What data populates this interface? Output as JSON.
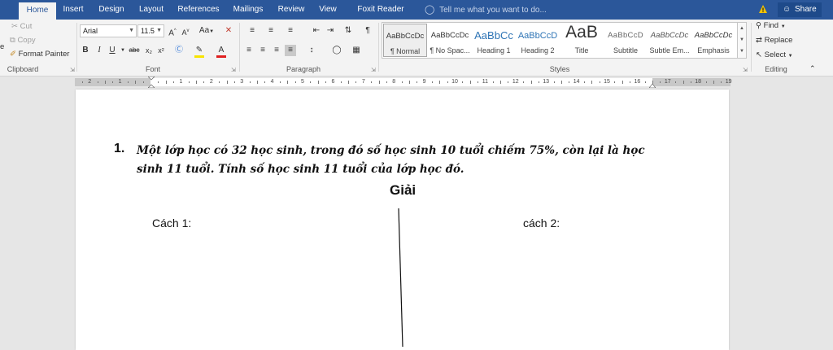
{
  "tabs": [
    "Home",
    "Insert",
    "Design",
    "Layout",
    "References",
    "Mailings",
    "Review",
    "View",
    "Foxit Reader PDF"
  ],
  "tell_me": "Tell me what you want to do...",
  "share": "Share",
  "clipboard": {
    "cut": "Cut",
    "copy": "Copy",
    "format_painter": "Format Painter",
    "label": "Clipboard"
  },
  "font": {
    "family": "Arial",
    "size": "11.5",
    "grow": "A",
    "shrink": "A",
    "case": "Aa",
    "bold": "B",
    "italic": "I",
    "underline": "U",
    "strike": "abc",
    "sub": "x₂",
    "sup": "x²",
    "label": "Font"
  },
  "paragraph": {
    "label": "Paragraph"
  },
  "styles": {
    "label": "Styles",
    "items": [
      {
        "preview": "AaBbCcDc",
        "name": "¶ Normal"
      },
      {
        "preview": "AaBbCcDc",
        "name": "¶ No Spac..."
      },
      {
        "preview": "AaBbCc",
        "name": "Heading 1"
      },
      {
        "preview": "AaBbCcD",
        "name": "Heading 2"
      },
      {
        "preview": "AaB",
        "name": "Title"
      },
      {
        "preview": "AaBbCcD",
        "name": "Subtitle"
      },
      {
        "preview": "AaBbCcDc",
        "name": "Subtle Em..."
      },
      {
        "preview": "AaBbCcDc",
        "name": "Emphasis"
      }
    ]
  },
  "editing": {
    "find": "Find",
    "replace": "Replace",
    "select": "Select",
    "label": "Editing"
  },
  "ruler": {
    "numbers": [
      "2",
      "1",
      "1",
      "2",
      "3",
      "4",
      "5",
      "6",
      "7",
      "8",
      "9",
      "10",
      "11",
      "12",
      "13",
      "14",
      "15",
      "16",
      "17",
      "18",
      "19"
    ]
  },
  "document": {
    "question_number": "1.",
    "question_line1": "Một lớp học có 32 học sinh, trong đó số học sinh 10 tuổi chiếm 75%, còn lại là học",
    "question_line2": "sinh 11 tuổi. Tính số học sinh 11 tuổi của lớp học đó.",
    "title": "Giải",
    "method1": "Cách 1:",
    "method2": "cách 2:"
  },
  "colors": {
    "accent": "#2b579a",
    "highlight": "#f7e400",
    "font_color": "#e02020"
  }
}
